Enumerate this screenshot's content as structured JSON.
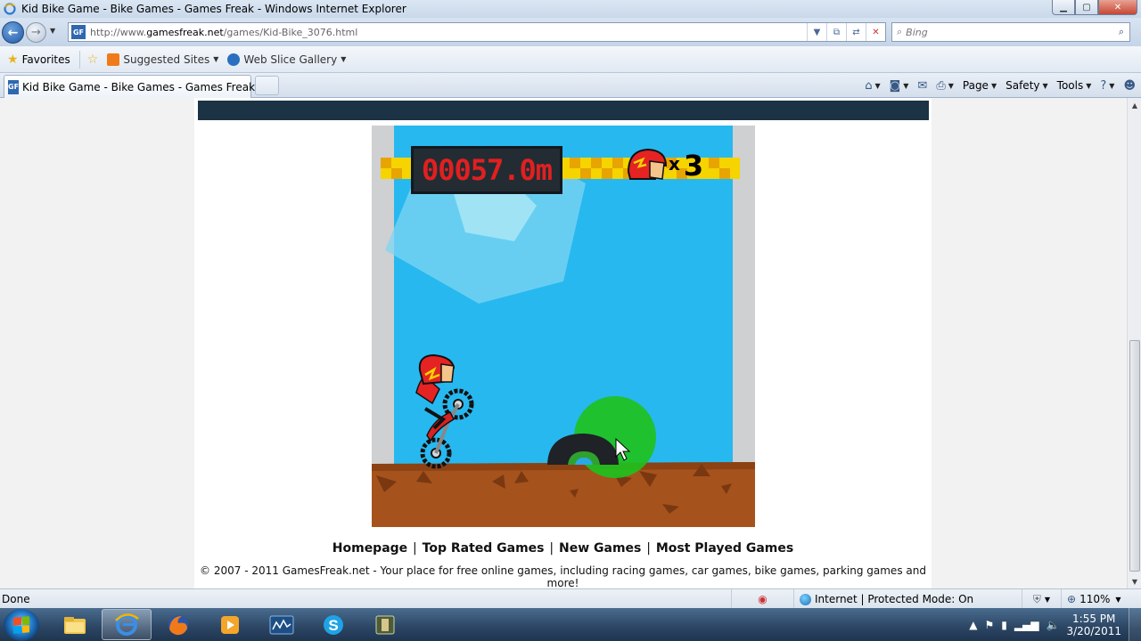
{
  "window": {
    "title": "Kid Bike Game - Bike Games - Games Freak - Windows Internet Explorer",
    "minimize": "▁",
    "maximize": "▢",
    "close": "✕"
  },
  "address": {
    "url_prefix": "http://www.",
    "url_host": "gamesfreak.net",
    "url_path": "/games/Kid-Bike_3076.html",
    "favicon": "GF",
    "search_placeholder": "Bing"
  },
  "favorites": {
    "label": "Favorites",
    "items": [
      {
        "label": "Suggested Sites",
        "color": "#f07a1a"
      },
      {
        "label": "Web Slice Gallery",
        "color": "#2a6fc0"
      }
    ]
  },
  "tab": {
    "label": "Kid Bike Game - Bike Games - Games Freak",
    "favicon": "GF"
  },
  "commands": {
    "page": "Page",
    "safety": "Safety",
    "tools": "Tools"
  },
  "game": {
    "distance": "00057.0m",
    "lives_x": "x",
    "lives": "3",
    "colors": {
      "sky": "#27b8f0",
      "ground": "#a6521c",
      "ring": "#1ec11e",
      "meter_text": "#e02020"
    }
  },
  "footer": {
    "links": [
      "Homepage",
      "Top Rated Games",
      "New Games",
      "Most Played Games"
    ],
    "separator": "|",
    "copyright": "© 2007 - 2011 GamesFreak.net - Your place for free online games, including racing games, car games, bike games, parking games and more!"
  },
  "status": {
    "text": "Done",
    "zone": "Internet | Protected Mode: On",
    "zoom": "110%"
  },
  "taskbar": {
    "time": "1:55 PM",
    "date": "3/20/2011"
  }
}
